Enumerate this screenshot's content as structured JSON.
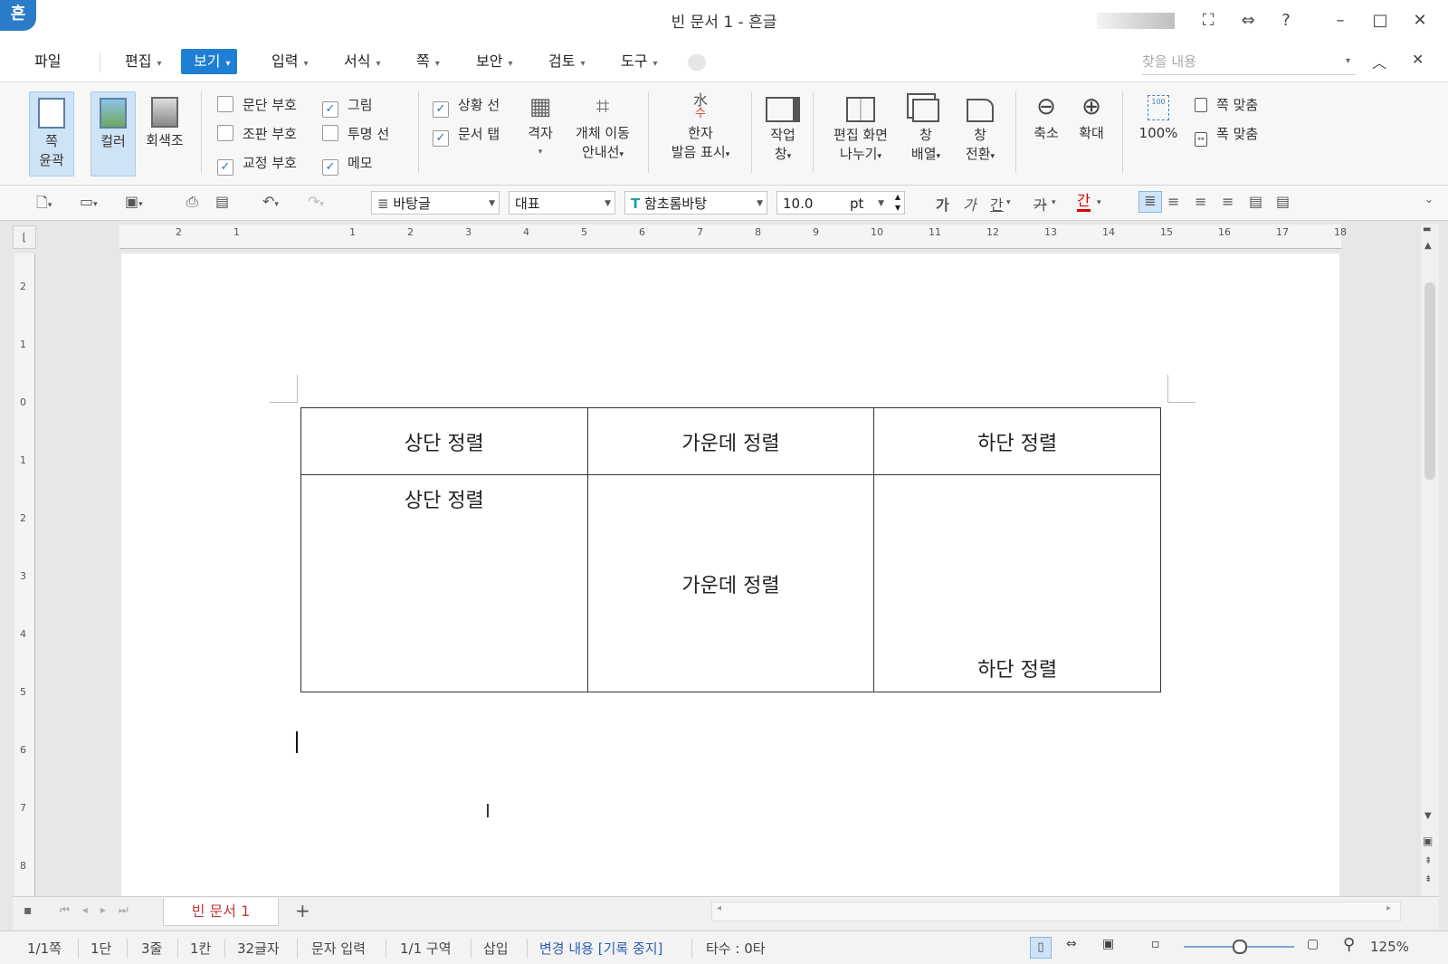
{
  "window": {
    "logo": "흔",
    "title": "빈 문서 1 - 흔글",
    "controls": {
      "fullscreen": "⛶",
      "split": "⇔",
      "help": "?",
      "minimize": "–",
      "maximize": "□",
      "close": "✕"
    }
  },
  "menubar": {
    "file": "파일",
    "items": [
      {
        "label": "편집"
      },
      {
        "label": "보기"
      },
      {
        "label": "입력"
      },
      {
        "label": "서식"
      },
      {
        "label": "쪽"
      },
      {
        "label": "보안"
      },
      {
        "label": "검토"
      },
      {
        "label": "도구"
      }
    ],
    "search_placeholder": "찾을 내용"
  },
  "ribbon": {
    "page_outline": {
      "line1": "쪽",
      "line2": "윤곽"
    },
    "color": "컬러",
    "grayscale": "회색조",
    "checks": [
      {
        "label": "문단 부호",
        "checked": false
      },
      {
        "label": "그림",
        "checked": true
      },
      {
        "label": "조판 부호",
        "checked": false
      },
      {
        "label": "투명 선",
        "checked": false
      },
      {
        "label": "교정 부호",
        "checked": true
      },
      {
        "label": "메모",
        "checked": true
      },
      {
        "label": "상황 선",
        "checked": true
      },
      {
        "label": "문서 탭",
        "checked": true
      }
    ],
    "check_mark": "✓",
    "grid": "격자",
    "object_move": {
      "line1": "개체 이동",
      "line2": "안내선"
    },
    "hanja": {
      "line1": "한자",
      "line2": "발음 표시"
    },
    "hanja_icon_top": "水",
    "hanja_icon_bottom": "수",
    "task_pane": {
      "line1": "작업",
      "line2": "창"
    },
    "split_view": {
      "line1": "편집 화면",
      "line2": "나누기"
    },
    "arrange": {
      "line1": "창",
      "line2": "배열"
    },
    "switch": {
      "line1": "창",
      "line2": "전환"
    },
    "zoom_out": "축소",
    "zoom_in": "확대",
    "zoom_100": "100%",
    "zoom_100_icon": "100",
    "fit_page": "쪽 맞춤",
    "fit_width": "폭 맞춤"
  },
  "toolbar": {
    "style": "바탕글",
    "lang": "대표",
    "font": "함초롬바탕",
    "font_icon": "T",
    "size": "10.0",
    "unit": "pt",
    "format_glyphs": [
      "가",
      "가",
      "간",
      "가",
      "간"
    ]
  },
  "ruler": {
    "h_ticks": [
      "2",
      "1",
      "1",
      "2",
      "3",
      "4",
      "5",
      "6",
      "7",
      "8",
      "9",
      "10",
      "11",
      "12",
      "13",
      "14",
      "15",
      "16",
      "17",
      "18"
    ],
    "v_ticks": [
      "2",
      "1",
      "0",
      "1",
      "2",
      "3",
      "4",
      "5",
      "6",
      "7",
      "8"
    ]
  },
  "document": {
    "table": {
      "headers": [
        "상단 정렬",
        "가운데 정렬",
        "하단 정렬"
      ],
      "body": [
        "상단 정렬",
        "가운데 정렬",
        "하단 정렬"
      ]
    }
  },
  "tabs": {
    "doc_tab": "빈 문서 1",
    "add": "+"
  },
  "statusbar": {
    "page": "1/1쪽",
    "column": "1단",
    "line": "3줄",
    "col": "1칸",
    "chars": "32글자",
    "mode": "문자 입력",
    "section": "1/1 구역",
    "insert": "삽입",
    "track": "변경 내용 [기록 중지]",
    "typing": "타수 : 0타",
    "zoom": "125%",
    "zoom_slider": 0.5
  }
}
